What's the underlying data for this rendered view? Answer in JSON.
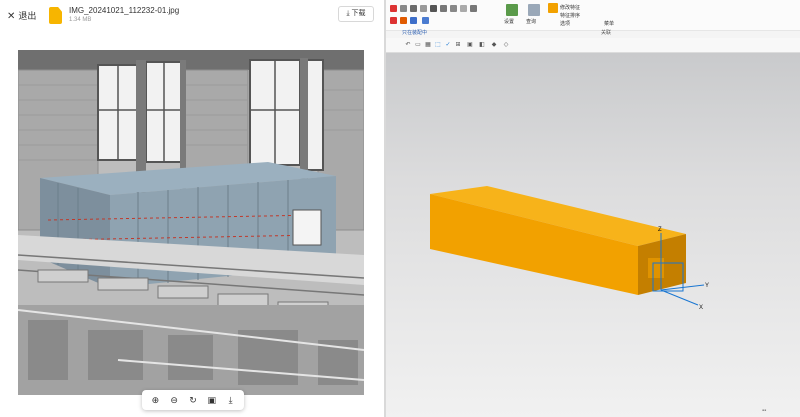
{
  "viewer": {
    "exit_label": "退出",
    "file_name": "IMG_20241021_112232-01.jpg",
    "file_size": "1.34 MB",
    "download_label": "下载",
    "toolbar": [
      "zoom-in",
      "zoom-out",
      "rotate",
      "fit-screen",
      "download"
    ]
  },
  "cad": {
    "ribbon_labels": [
      "设置",
      "查询",
      "修改特征",
      "特征排序",
      "选项",
      "菜单"
    ],
    "breadcrumb": "只在装配中",
    "group_label": "关联",
    "axes": [
      "Z",
      "Y",
      "X"
    ]
  },
  "colors": {
    "body": "#f2a100",
    "body_dark": "#c47f00",
    "body_top": "#f7b31a",
    "accent": "#1976d2"
  }
}
